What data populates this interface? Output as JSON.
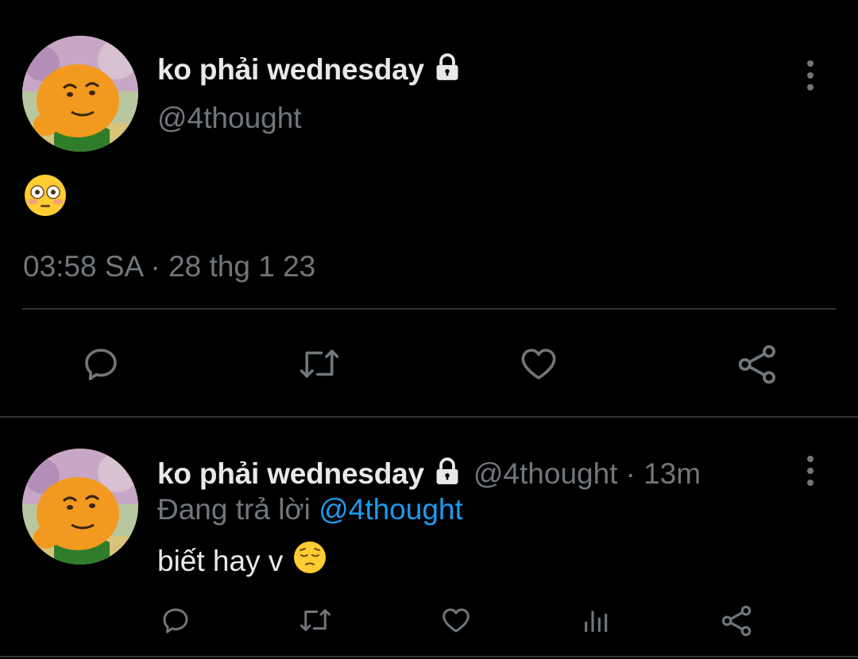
{
  "main_tweet": {
    "display_name": "ko phải wednesday",
    "handle": "@4thought",
    "content_emoji": "flushed-face",
    "timestamp": "03:58 SA · 28 thg 1 23",
    "actions": [
      "reply",
      "retweet",
      "like",
      "share"
    ]
  },
  "reply_tweet": {
    "display_name": "ko phải wednesday",
    "handle": "@4thought",
    "time_ago": "· 13m",
    "replying_prefix": "Đang trả lời",
    "replying_to": "@4thought",
    "text": "biết hay v",
    "text_emoji": "pensive-face",
    "actions": [
      "reply",
      "retweet",
      "like",
      "views",
      "share"
    ]
  },
  "colors": {
    "background": "#000000",
    "primary_text": "#e7e9ea",
    "secondary_text": "#71767b",
    "link": "#1d9bf0",
    "divider": "#2f3336"
  }
}
